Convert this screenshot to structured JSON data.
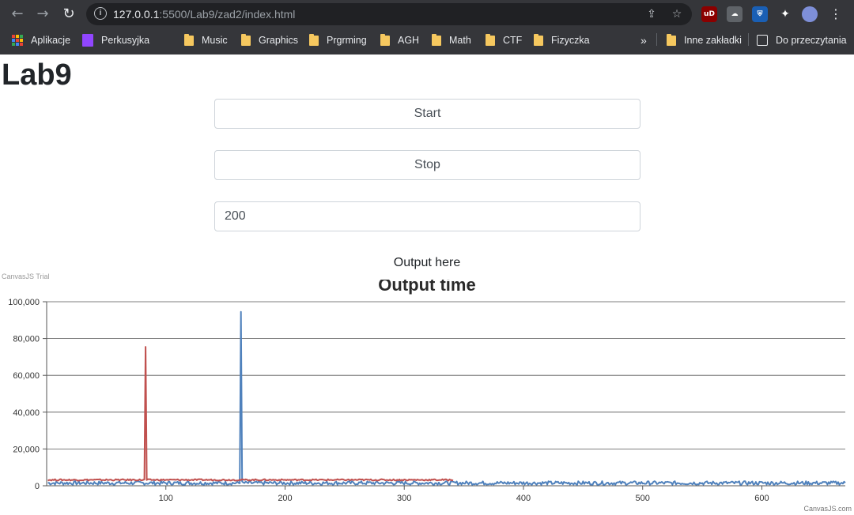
{
  "browser": {
    "url_host": "127.0.0.1",
    "url_rest": ":5500/Lab9/zad2/index.html",
    "bookmarks": [
      "Aplikacje",
      "Perkusyjka",
      "Music",
      "Graphics",
      "Prgrming",
      "AGH",
      "Math",
      "CTF",
      "Fizyczka"
    ],
    "overflow_label": "»",
    "other_bookmarks": "Inne zakładki",
    "reading_list": "Do przeczytania",
    "ext_ublock": "uD"
  },
  "page": {
    "title": "Lab9",
    "start_label": "Start",
    "stop_label": "Stop",
    "interval_value": "200",
    "output_text": "Output here",
    "trial_text": "CanvasJS Trial",
    "credit_text": "CanvasJS.com"
  },
  "colors": {
    "series_red": "#c0504e",
    "series_blue": "#4f81bc"
  },
  "chart_data": {
    "type": "line",
    "title": "Output time",
    "xlabel": "",
    "ylabel": "",
    "xlim": [
      0,
      670
    ],
    "ylim": [
      0,
      100000
    ],
    "y_ticks": [
      "0",
      "20,000",
      "40,000",
      "60,000",
      "80,000",
      "100,000"
    ],
    "x_ticks": [
      "100",
      "200",
      "300",
      "400",
      "500",
      "600"
    ],
    "grid": true,
    "legend": "none",
    "series": [
      {
        "color": "#4f81bc",
        "x_range": [
          1,
          670
        ],
        "baseline": 1500,
        "jitter": 1000,
        "spikes": [
          {
            "x": 163,
            "y": 94500
          }
        ]
      },
      {
        "color": "#c0504e",
        "x_range": [
          1,
          341
        ],
        "baseline": 3200,
        "jitter": 400,
        "spikes": [
          {
            "x": 83,
            "y": 75500
          }
        ]
      }
    ]
  }
}
